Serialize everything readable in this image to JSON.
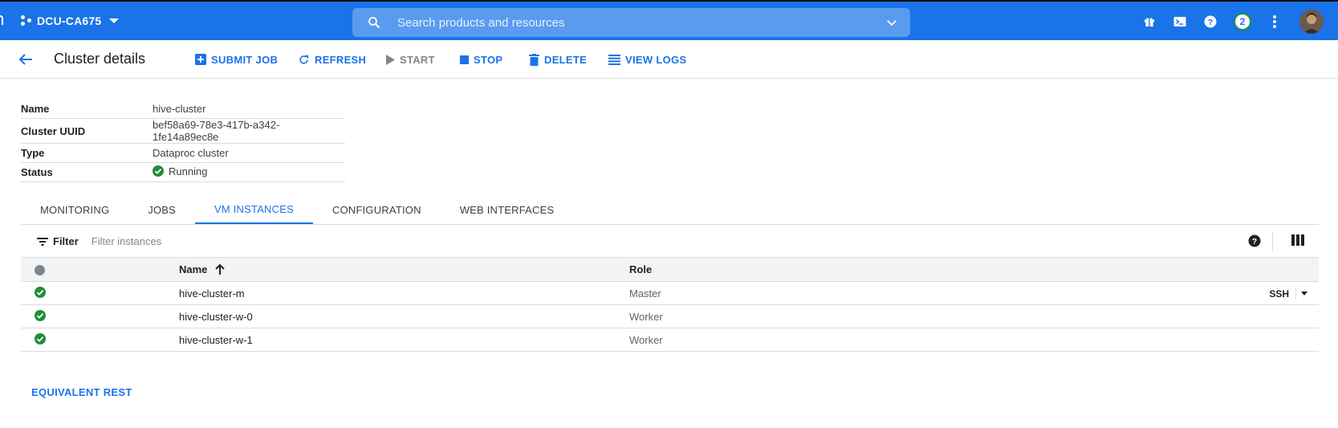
{
  "header": {
    "project": "DCU-CA675",
    "search_placeholder": "Search products and resources",
    "notification_count": "2",
    "icons": [
      "gift-icon",
      "cloud-shell-icon",
      "help-icon",
      "more-vert-icon"
    ]
  },
  "actionbar": {
    "title": "Cluster details",
    "actions": {
      "submit_job": "SUBMIT JOB",
      "refresh": "REFRESH",
      "start": "START",
      "stop": "STOP",
      "delete": "DELETE",
      "view_logs": "VIEW LOGS"
    }
  },
  "details": {
    "name_label": "Name",
    "name_value": "hive-cluster",
    "uuid_label": "Cluster UUID",
    "uuid_value": "bef58a69-78e3-417b-a342-1fe14a89ec8e",
    "type_label": "Type",
    "type_value": "Dataproc cluster",
    "status_label": "Status",
    "status_value": "Running"
  },
  "tabs": [
    "MONITORING",
    "JOBS",
    "VM INSTANCES",
    "CONFIGURATION",
    "WEB INTERFACES"
  ],
  "active_tab": "VM INSTANCES",
  "filter": {
    "label": "Filter",
    "placeholder": "Filter instances"
  },
  "instances": {
    "columns": {
      "name": "Name",
      "role": "Role"
    },
    "rows": [
      {
        "name": "hive-cluster-m",
        "role": "Master",
        "action": "SSH"
      },
      {
        "name": "hive-cluster-w-0",
        "role": "Worker"
      },
      {
        "name": "hive-cluster-w-1",
        "role": "Worker"
      }
    ]
  },
  "footer": {
    "equivalent_rest": "EQUIVALENT REST"
  },
  "colors": {
    "brand": "#1a73e8",
    "success": "#1e8e3e",
    "disabled": "#80868b"
  }
}
